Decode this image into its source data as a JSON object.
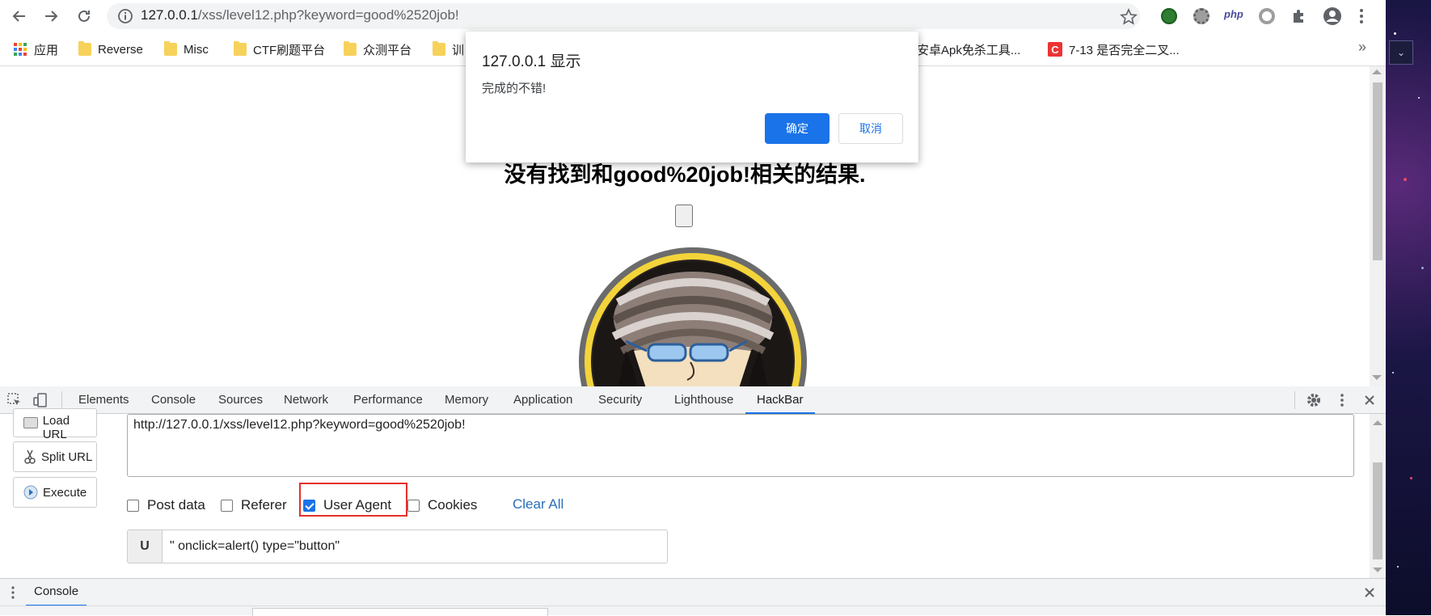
{
  "browser": {
    "url_host": "127.0.0.1",
    "url_path": "/xss/level12.php?keyword=good%2520job!"
  },
  "bookmarks": [
    {
      "label": "应用",
      "icon": "apps-grid-icon"
    },
    {
      "label": "Reverse",
      "icon": "folder-icon"
    },
    {
      "label": "Misc",
      "icon": "folder-icon"
    },
    {
      "label": "CTF刷题平台",
      "icon": "folder-icon"
    },
    {
      "label": "众测平台",
      "icon": "folder-icon"
    },
    {
      "label": "训",
      "icon": "folder-icon"
    },
    {
      "label": "安卓Apk免杀工具...",
      "icon": ""
    },
    {
      "label": "7-13 是否完全二叉...",
      "icon": "csdn-icon"
    }
  ],
  "dialog": {
    "title": "127.0.0.1 显示",
    "message": "完成的不错!",
    "ok_label": "确定",
    "cancel_label": "取消"
  },
  "page": {
    "heading": "没有找到和good%20job!相关的结果."
  },
  "devtools": {
    "tabs": [
      "Elements",
      "Console",
      "Sources",
      "Network",
      "Performance",
      "Memory",
      "Application",
      "Security",
      "Lighthouse",
      "HackBar"
    ],
    "active_tab": "HackBar",
    "drawer_tab": "Console"
  },
  "hackbar": {
    "load_url_label": "Load URL",
    "split_url_label": "Split URL",
    "execute_label": "Execute",
    "url_value": "http://127.0.0.1/xss/level12.php?keyword=good%2520job!",
    "options": [
      {
        "label": "Post data",
        "checked": false
      },
      {
        "label": "Referer",
        "checked": false
      },
      {
        "label": "User Agent",
        "checked": true
      },
      {
        "label": "Cookies",
        "checked": false
      }
    ],
    "clear_all_label": "Clear All",
    "ua_prefix": "U",
    "ua_value": "\" onclick=alert() type=\"button\""
  },
  "colors": {
    "accent": "#1a73e8",
    "highlight": "#e5302b"
  }
}
